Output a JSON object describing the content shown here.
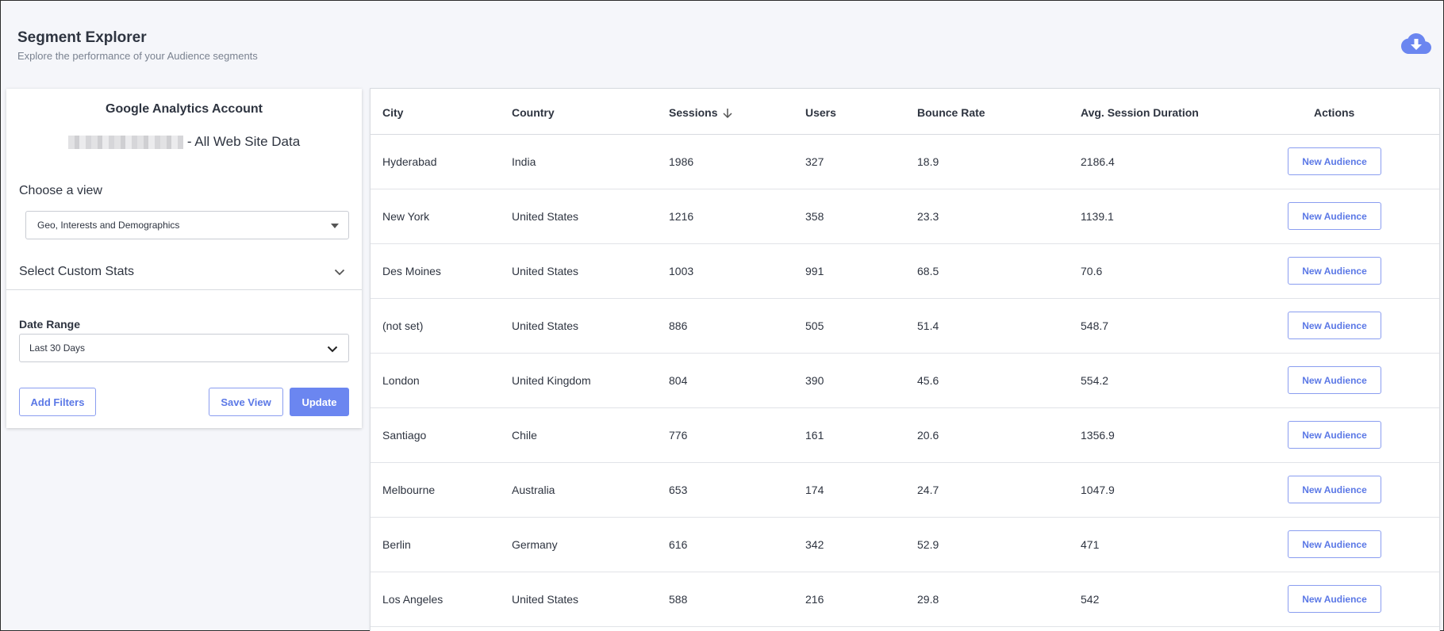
{
  "header": {
    "title": "Segment Explorer",
    "subtitle": "Explore the performance of your Audience segments"
  },
  "left_panel": {
    "account_title": "Google Analytics Account",
    "account_suffix": "- All Web Site Data",
    "choose_view_label": "Choose a view",
    "view_selected": "Geo, Interests and Demographics",
    "custom_stats_label": "Select Custom Stats",
    "date_range_label": "Date Range",
    "date_range_selected": "Last 30 Days",
    "add_filters_label": "Add Filters",
    "save_view_label": "Save View",
    "update_label": "Update"
  },
  "table": {
    "columns": [
      "City",
      "Country",
      "Sessions",
      "Users",
      "Bounce Rate",
      "Avg. Session Duration",
      "Actions"
    ],
    "sorted_column": "Sessions",
    "sort_direction": "descending",
    "action_label": "New Audience",
    "rows": [
      {
        "city": "Hyderabad",
        "country": "India",
        "sessions": "1986",
        "users": "327",
        "bounce_rate": "18.9",
        "avg_duration": "2186.4"
      },
      {
        "city": "New York",
        "country": "United States",
        "sessions": "1216",
        "users": "358",
        "bounce_rate": "23.3",
        "avg_duration": "1139.1"
      },
      {
        "city": "Des Moines",
        "country": "United States",
        "sessions": "1003",
        "users": "991",
        "bounce_rate": "68.5",
        "avg_duration": "70.6"
      },
      {
        "city": "(not set)",
        "country": "United States",
        "sessions": "886",
        "users": "505",
        "bounce_rate": "51.4",
        "avg_duration": "548.7"
      },
      {
        "city": "London",
        "country": "United Kingdom",
        "sessions": "804",
        "users": "390",
        "bounce_rate": "45.6",
        "avg_duration": "554.2"
      },
      {
        "city": "Santiago",
        "country": "Chile",
        "sessions": "776",
        "users": "161",
        "bounce_rate": "20.6",
        "avg_duration": "1356.9"
      },
      {
        "city": "Melbourne",
        "country": "Australia",
        "sessions": "653",
        "users": "174",
        "bounce_rate": "24.7",
        "avg_duration": "1047.9"
      },
      {
        "city": "Berlin",
        "country": "Germany",
        "sessions": "616",
        "users": "342",
        "bounce_rate": "52.9",
        "avg_duration": "471"
      },
      {
        "city": "Los Angeles",
        "country": "United States",
        "sessions": "588",
        "users": "216",
        "bounce_rate": "29.8",
        "avg_duration": "542"
      }
    ]
  },
  "icons": {
    "download": "cloud-download-icon",
    "sort": "arrow-down-icon",
    "expand": "chevron-down-icon"
  },
  "colors": {
    "accent": "#6b86f0",
    "accent_text": "#5b78e6",
    "background": "#f5f6fa"
  }
}
